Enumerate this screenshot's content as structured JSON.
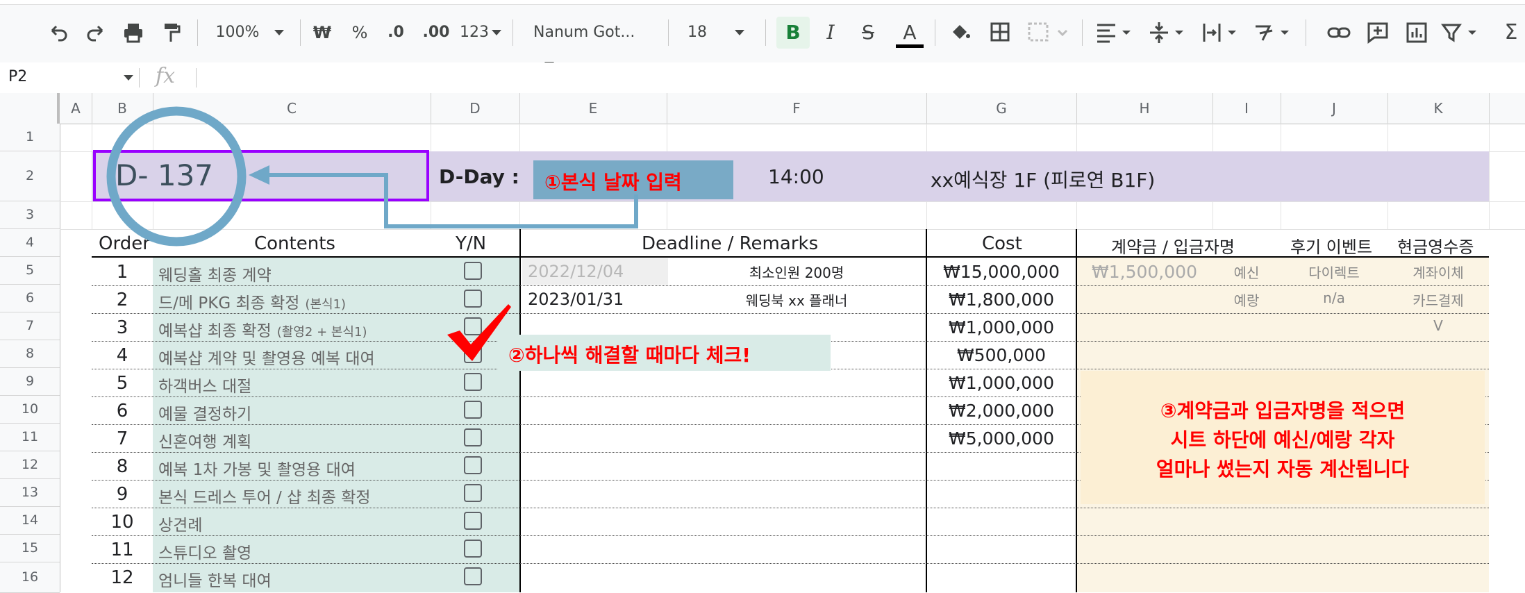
{
  "toolbar": {
    "zoom": "100%",
    "currency": "₩",
    "percent": "%",
    "dec_decrease": ".0",
    "dec_increase": ".00",
    "format_more": "123",
    "font_name": "Nanum Got...",
    "font_size": "18",
    "bold": "B",
    "italic": "I",
    "strike": "S",
    "text_color": "A"
  },
  "formula_bar": {
    "cell_ref": "P2",
    "fx": "fx"
  },
  "columns": [
    "A",
    "B",
    "C",
    "D",
    "E",
    "F",
    "G",
    "H",
    "I",
    "J",
    "K"
  ],
  "rows": [
    "1",
    "2",
    "3",
    "4",
    "5",
    "6",
    "7",
    "8",
    "9",
    "10",
    "11",
    "12",
    "13",
    "14",
    "15",
    "16"
  ],
  "dday": {
    "countdown": "D- 137",
    "label": "D-Day :",
    "date_button": "①본식 날짜 입력",
    "time": "14:00",
    "venue": "xx예식장 1F (피로연 B1F)"
  },
  "table": {
    "headers": {
      "order": "Order",
      "contents": "Contents",
      "yn": "Y/N",
      "deadline": "Deadline / Remarks",
      "cost": "Cost",
      "deposit": "계약금 / 입금자명",
      "review": "후기 이벤트",
      "receipt": "현금영수증"
    },
    "rows": [
      {
        "order": "1",
        "content": "웨딩홀 최종 계약",
        "note": "",
        "deadline": "2022/12/04",
        "remark": "최소인원 200명",
        "cost": "₩15,000,000",
        "deposit": "₩1,500,000",
        "payer": "예신",
        "review": "다이렉트",
        "receipt": "계좌이체"
      },
      {
        "order": "2",
        "content": "드/메 PKG 최종 확정",
        "note": "(본식1)",
        "deadline": "2023/01/31",
        "remark": "웨딩북 xx 플래너",
        "cost": "₩1,800,000",
        "deposit": "",
        "payer": "예랑",
        "review": "n/a",
        "receipt": "카드결제"
      },
      {
        "order": "3",
        "content": "예복샵 최종 확정",
        "note": "(촬영2 + 본식1)",
        "deadline": "",
        "remark": "",
        "cost": "₩1,000,000",
        "deposit": "",
        "payer": "",
        "review": "",
        "receipt": "V"
      },
      {
        "order": "4",
        "content": "예복샵 계약 및 촬영용 예복 대여",
        "note": "",
        "deadline": "",
        "remark": "",
        "cost": "₩500,000",
        "deposit": "",
        "payer": "",
        "review": "",
        "receipt": ""
      },
      {
        "order": "5",
        "content": "하객버스 대절",
        "note": "",
        "deadline": "",
        "remark": "",
        "cost": "₩1,000,000",
        "deposit": "",
        "payer": "",
        "review": "",
        "receipt": ""
      },
      {
        "order": "6",
        "content": "예물 결정하기",
        "note": "",
        "deadline": "",
        "remark": "",
        "cost": "₩2,000,000",
        "deposit": "",
        "payer": "",
        "review": "",
        "receipt": ""
      },
      {
        "order": "7",
        "content": "신혼여행 계획",
        "note": "",
        "deadline": "",
        "remark": "",
        "cost": "₩5,000,000",
        "deposit": "",
        "payer": "",
        "review": "",
        "receipt": ""
      },
      {
        "order": "8",
        "content": "예복 1차 가봉 및 촬영용 대여",
        "note": "",
        "deadline": "",
        "remark": "",
        "cost": "",
        "deposit": "",
        "payer": "",
        "review": "",
        "receipt": ""
      },
      {
        "order": "9",
        "content": "본식 드레스 투어 / 샵 최종 확정",
        "note": "",
        "deadline": "",
        "remark": "",
        "cost": "",
        "deposit": "",
        "payer": "",
        "review": "",
        "receipt": ""
      },
      {
        "order": "10",
        "content": "상견례",
        "note": "",
        "deadline": "",
        "remark": "",
        "cost": "",
        "deposit": "",
        "payer": "",
        "review": "",
        "receipt": ""
      },
      {
        "order": "11",
        "content": "스튜디오 촬영",
        "note": "",
        "deadline": "",
        "remark": "",
        "cost": "",
        "deposit": "",
        "payer": "",
        "review": "",
        "receipt": ""
      },
      {
        "order": "12",
        "content": "엄니들 한복 대여",
        "note": "",
        "deadline": "",
        "remark": "",
        "cost": "",
        "deposit": "",
        "payer": "",
        "review": "",
        "receipt": ""
      }
    ]
  },
  "callouts": {
    "check_tip": "②하나씩 해결할 때마다 체크!",
    "deposit_tip_line1": "③계약금과 입금자명을 적으면",
    "deposit_tip_line2": "시트 하단에 예신/예랑 각자",
    "deposit_tip_line3": "얼마나 썼는지 자동 계산됩니다"
  },
  "colors": {
    "purple_band": "#d9d2e9",
    "teal_cells": "#d9ebe7",
    "beige_cells": "#fbf4e4",
    "annotation_blue": "#6fa8c8",
    "callout_red": "#ff0000"
  }
}
